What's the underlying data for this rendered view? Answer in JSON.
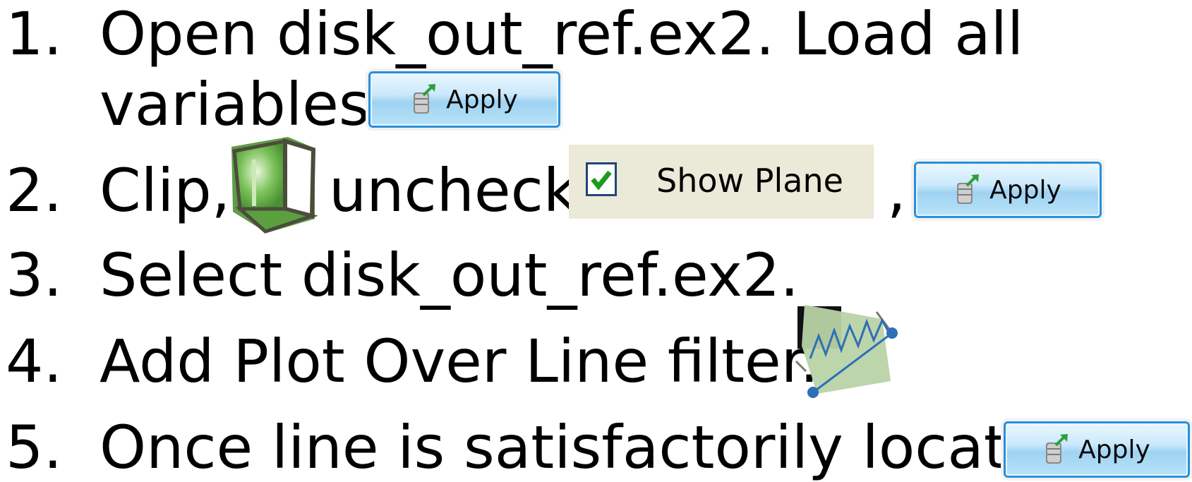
{
  "steps": [
    {
      "number": "1.",
      "line1": "Open disk_out_ref.ex2.  Load all",
      "line2": "variables."
    },
    {
      "number": "2.",
      "before_icon": "Clip,",
      "after_icon": "uncheck,",
      "after_checkbox": ","
    },
    {
      "number": "3.",
      "text": "Select disk_out_ref.ex2."
    },
    {
      "number": "4.",
      "text": "Add Plot Over Line filter."
    },
    {
      "number": "5.",
      "text": "Once line is satisfactorily located,"
    }
  ],
  "apply_label": "Apply",
  "show_plane_label": "Show Plane",
  "icons": {
    "apply": "server-arrow-icon",
    "clip": "green-cube-clip-icon",
    "checkbox": "checked-checkbox-icon",
    "plot_over_line": "plot-over-line-icon"
  },
  "colors": {
    "apply_border": "#2a8fd8",
    "apply_fill": "#b9e2f8",
    "clip_green": "#6fbe4a",
    "checkbox_border": "#21457a",
    "check_green": "#1c9b1c",
    "panel_bg": "#ebe9d8",
    "plot_line": "#2f6fb5"
  }
}
